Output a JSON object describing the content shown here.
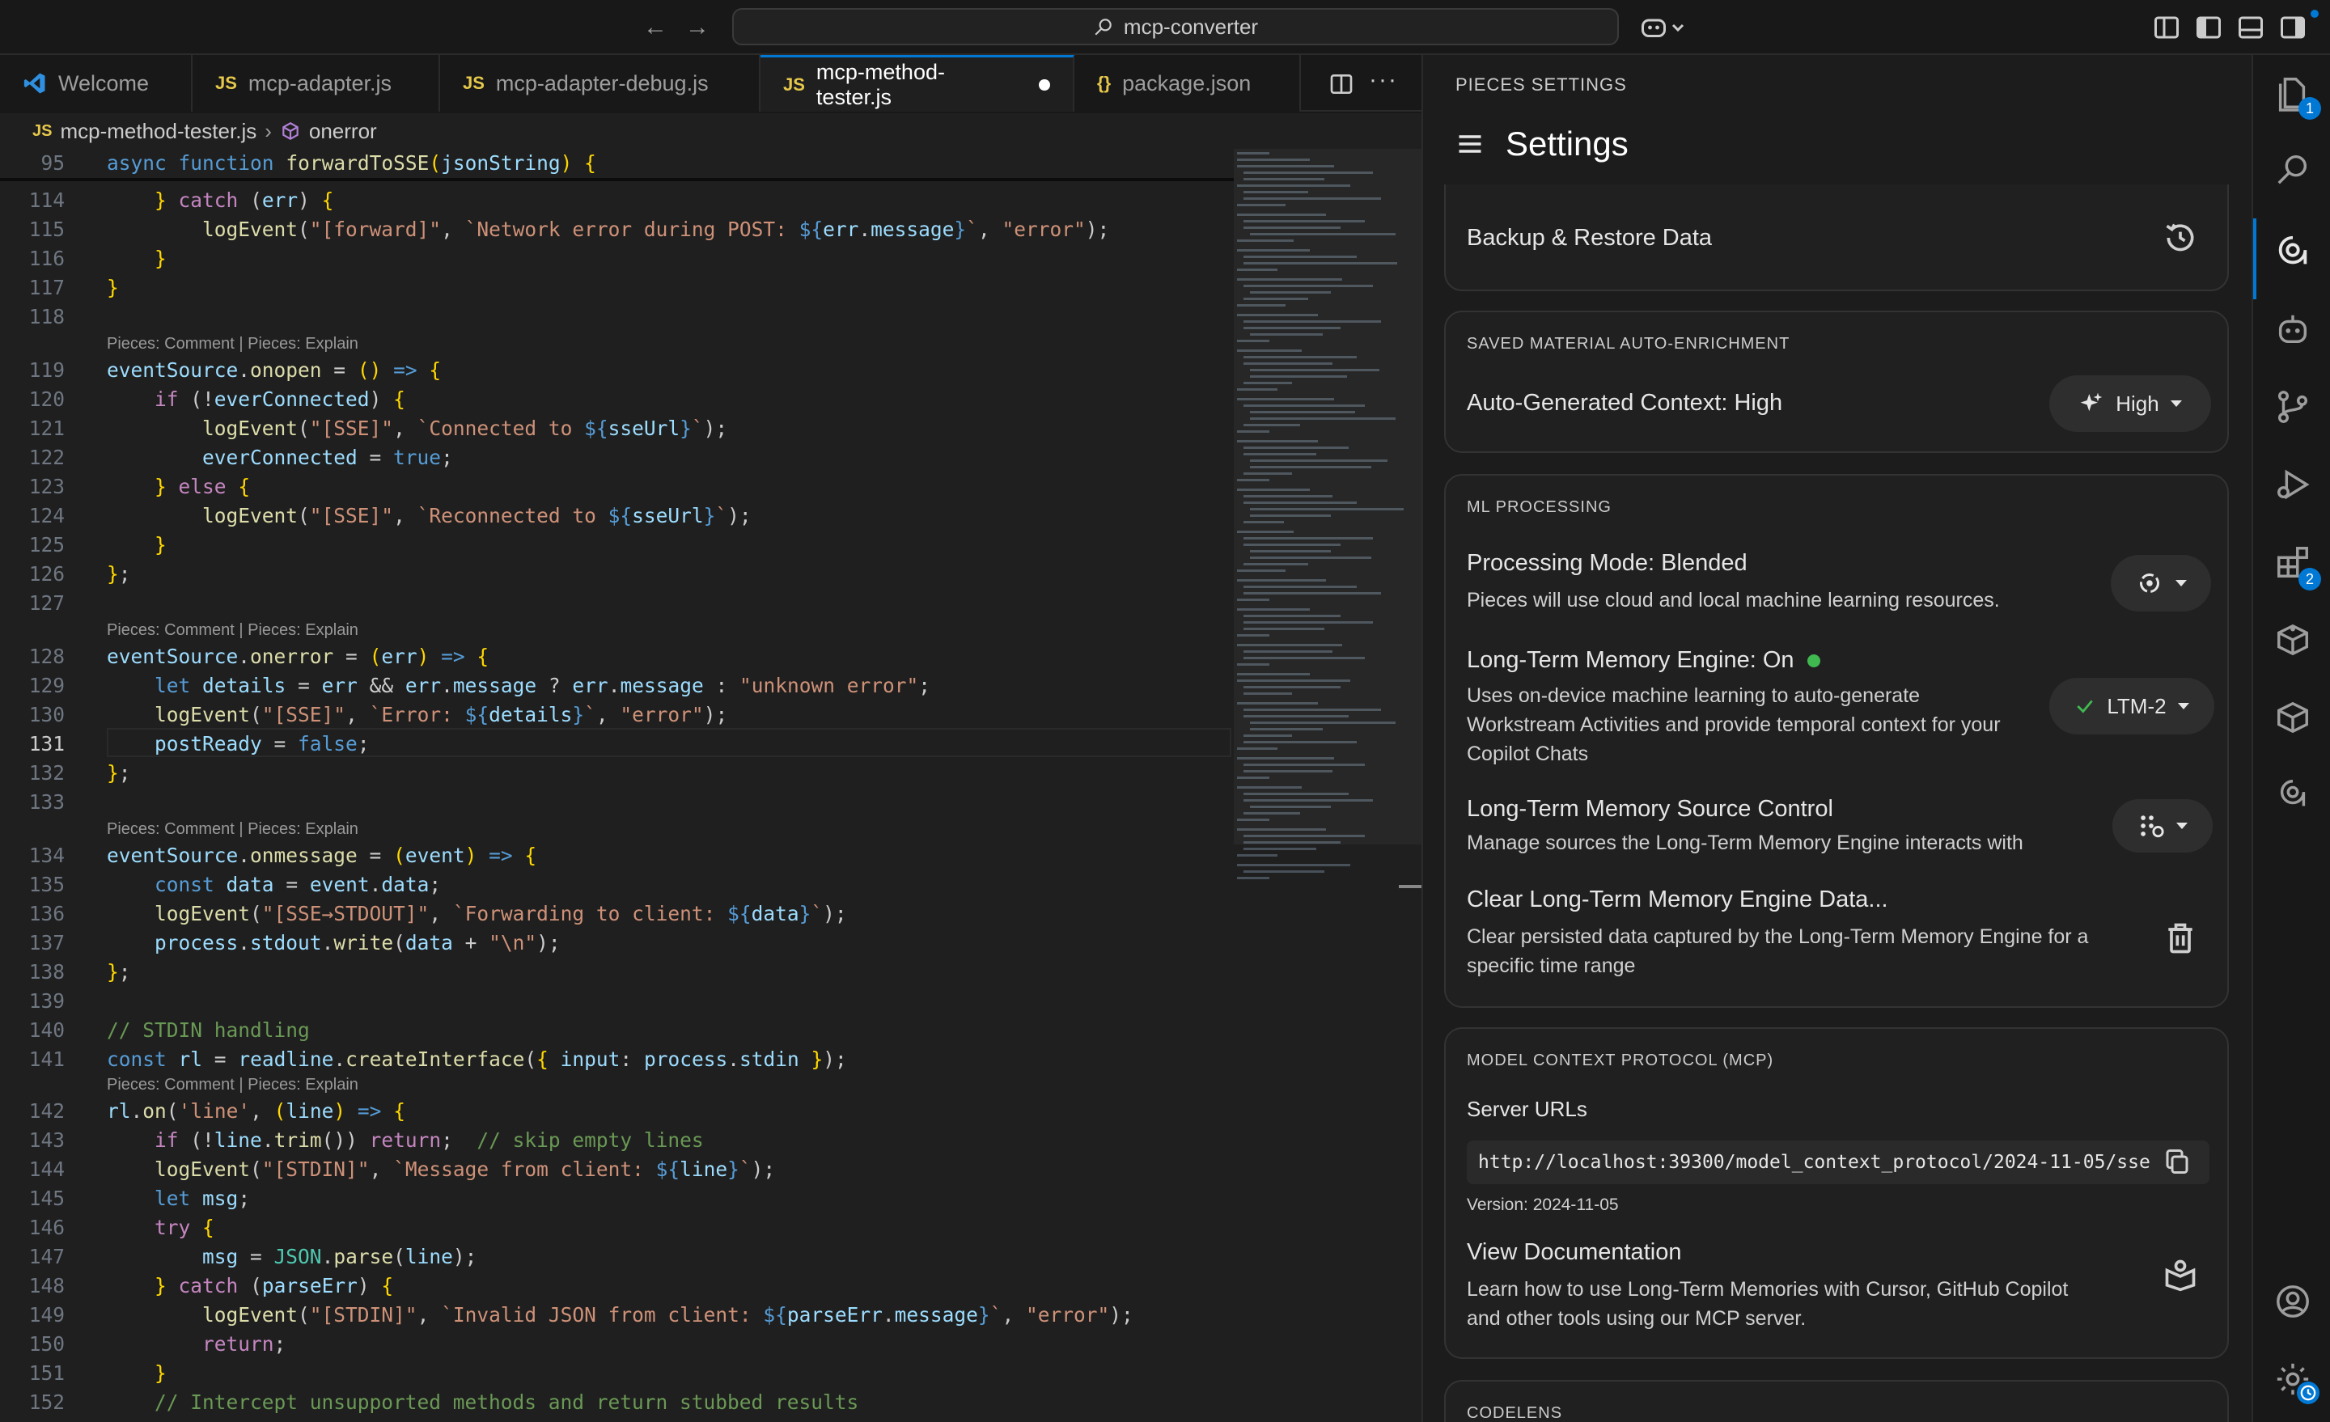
{
  "titlebar": {
    "search_label": "mcp-converter"
  },
  "tabs": [
    {
      "label": "Welcome"
    },
    {
      "label": "mcp-adapter.js"
    },
    {
      "label": "mcp-adapter-debug.js"
    },
    {
      "label": "mcp-method-tester.js"
    },
    {
      "label": "package.json"
    }
  ],
  "breadcrumb": {
    "file": "mcp-method-tester.js",
    "symbol": "onerror"
  },
  "editor": {
    "codelens": "Pieces: Comment | Pieces: Explain",
    "lines": {
      "l95": "95",
      "l114": "114",
      "l115": "115",
      "l116": "116",
      "l117": "117",
      "l118": "118",
      "l119": "119",
      "l120": "120",
      "l121": "121",
      "l122": "122",
      "l123": "123",
      "l124": "124",
      "l125": "125",
      "l126": "126",
      "l127": "127",
      "l128": "128",
      "l129": "129",
      "l130": "130",
      "l131": "131",
      "l132": "132",
      "l133": "133",
      "l134": "134",
      "l135": "135",
      "l136": "136",
      "l137": "137",
      "l138": "138",
      "l139": "139",
      "l140": "140",
      "l141": "141",
      "l142": "142",
      "l143": "143",
      "l144": "144",
      "l145": "145",
      "l146": "146",
      "l147": "147",
      "l148": "148",
      "l149": "149",
      "l150": "150",
      "l151": "151",
      "l152": "152"
    }
  },
  "panel": {
    "header": "PIECES SETTINGS",
    "title": "Settings",
    "backup_label": "Backup & Restore Data",
    "enrichment": {
      "section": "SAVED MATERIAL AUTO-ENRICHMENT",
      "label": "Auto-Generated Context: High",
      "button": "High"
    },
    "ml": {
      "section": "ML PROCESSING",
      "processing_title": "Processing Mode: Blended",
      "processing_desc": "Pieces will use cloud and local machine learning resources.",
      "ltm_title": "Long-Term Memory Engine: On",
      "ltm_desc_1": "Uses on-device machine learning to auto-generate",
      "ltm_desc_2": "Workstream Activities and provide temporal context for your",
      "ltm_desc_3": "Copilot Chats",
      "ltm_button": "LTM-2",
      "source_title": "Long-Term Memory Source Control",
      "source_desc": "Manage sources the Long-Term Memory Engine interacts with",
      "clear_title": "Clear Long-Term Memory Engine Data...",
      "clear_desc_1": "Clear persisted data captured by the Long-Term Memory Engine for a",
      "clear_desc_2": "specific time range"
    },
    "mcp": {
      "section": "MODEL CONTEXT PROTOCOL (MCP)",
      "server_urls": "Server URLs",
      "url": "http://localhost:39300/model_context_protocol/2024-11-05/sse",
      "version": "Version: 2024-11-05",
      "docs_title": "View Documentation",
      "docs_desc_1": "Learn how to use Long-Term Memories with Cursor, GitHub Copilot",
      "docs_desc_2": "and other tools using our MCP server."
    },
    "codelens_section": "CODELENS"
  },
  "activity": {
    "explorer_badge": "1",
    "extensions_badge": "2"
  },
  "colors": {
    "accent": "#0078d4",
    "status_on": "#3fb950"
  }
}
